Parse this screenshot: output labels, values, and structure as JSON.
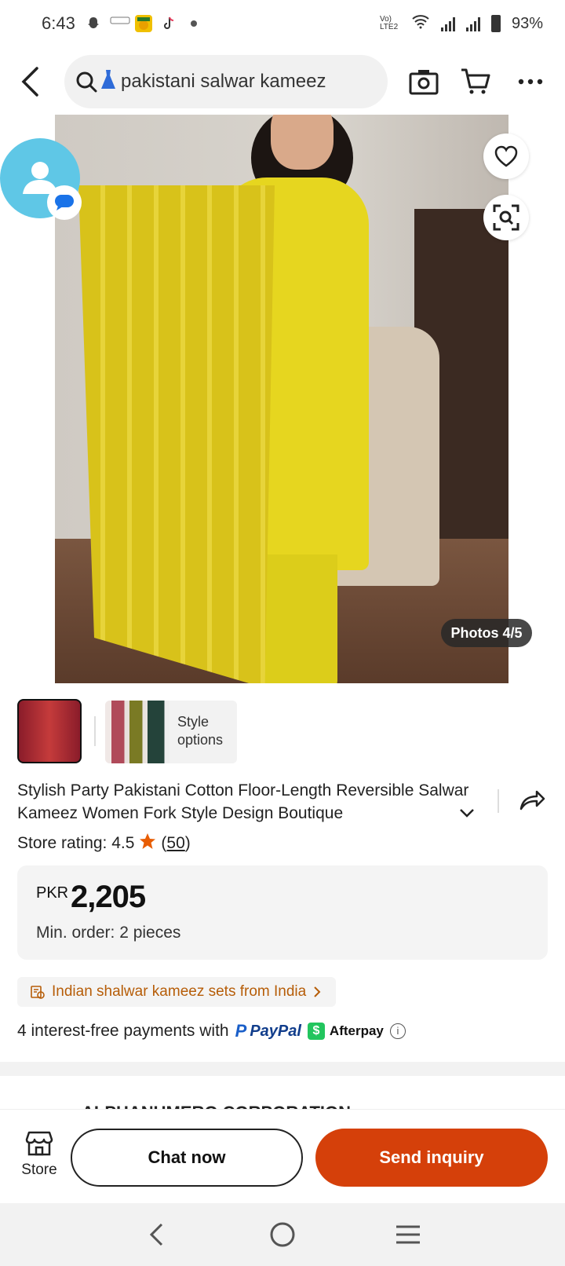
{
  "status_bar": {
    "time": "6:43",
    "network": "Vo) LTE2",
    "battery": "93%"
  },
  "search": {
    "query": "pakistani salwar kameez"
  },
  "gallery": {
    "photos_badge": "Photos 4/5"
  },
  "style_options": {
    "label": "Style options"
  },
  "product": {
    "title": "Stylish Party Pakistani Cotton Floor-Length Reversible Salwar Kameez Women Fork Style Design Boutique",
    "rating_label": "Store rating: 4.5",
    "rating_count_open": "(",
    "rating_count": "50",
    "rating_count_close": ")",
    "rating_value": 4.5,
    "currency": "PKR",
    "price": "2,205",
    "min_order": "Min. order: 2 pieces",
    "promo": "Indian shalwar kameez sets from India",
    "payments_text": "4 interest-free payments with",
    "paypal": "PayPal",
    "afterpay": "Afterpay"
  },
  "supplier": {
    "peek_text": "ALPHANUMERO CORPORATION"
  },
  "actions": {
    "store_label": "Store",
    "chat_now": "Chat now",
    "send_inquiry": "Send inquiry"
  },
  "colors": {
    "accent": "#d5400a",
    "promo_text": "#b65d08",
    "rating_star": "#e85d04",
    "chat_bubble": "#5fc7e6"
  }
}
